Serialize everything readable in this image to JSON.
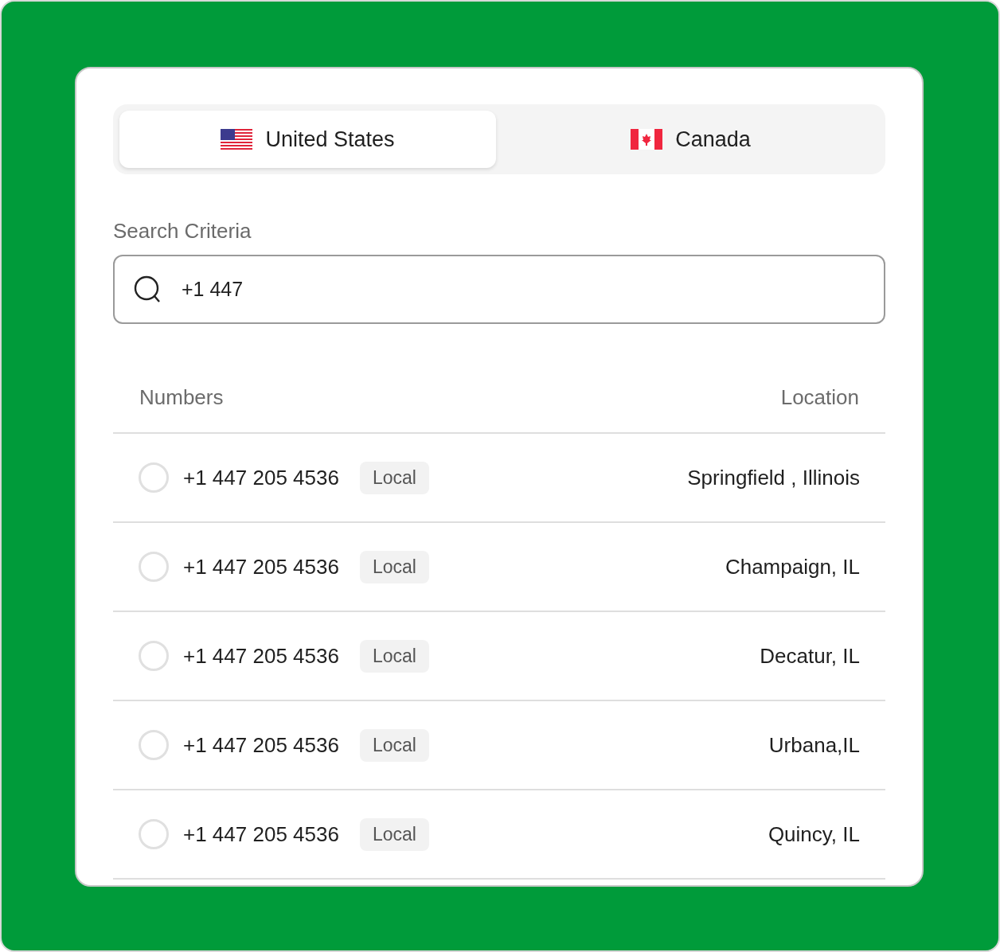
{
  "tabs": [
    {
      "label": "United States",
      "kind": "us",
      "selected": true
    },
    {
      "label": "Canada",
      "kind": "ca",
      "selected": false
    }
  ],
  "search": {
    "label": "Search Criteria",
    "value": "+1 447"
  },
  "table": {
    "columns": [
      "Numbers",
      "Location"
    ],
    "rows": [
      {
        "number": "+1 447 205 4536",
        "tag": "Local",
        "location": "Springfield , Illinois",
        "selected": false
      },
      {
        "number": "+1 447 205 4536",
        "tag": "Local",
        "location": "Champaign, IL",
        "selected": false
      },
      {
        "number": "+1 447 205 4536",
        "tag": "Local",
        "location": "Decatur, IL",
        "selected": false
      },
      {
        "number": "+1 447 205 4536",
        "tag": "Local",
        "location": "Urbana,IL",
        "selected": false
      },
      {
        "number": "+1 447 205 4536",
        "tag": "Local",
        "location": "Quincy, IL",
        "selected": false
      }
    ]
  }
}
